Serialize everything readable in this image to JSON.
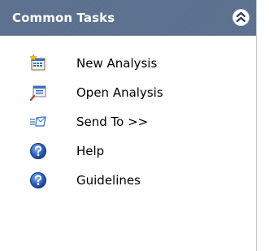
{
  "panel": {
    "title": "Common Tasks",
    "header_color": "#5a6f8d",
    "collapse_icon": "double-chevron-up-icon",
    "items": [
      {
        "label": "New Analysis",
        "icon": "new-analysis-icon"
      },
      {
        "label": "Open Analysis",
        "icon": "open-analysis-icon"
      },
      {
        "label": "Send To >>",
        "icon": "send-to-icon"
      },
      {
        "label": "Help",
        "icon": "help-icon"
      },
      {
        "label": "Guidelines",
        "icon": "guidelines-icon"
      }
    ]
  }
}
